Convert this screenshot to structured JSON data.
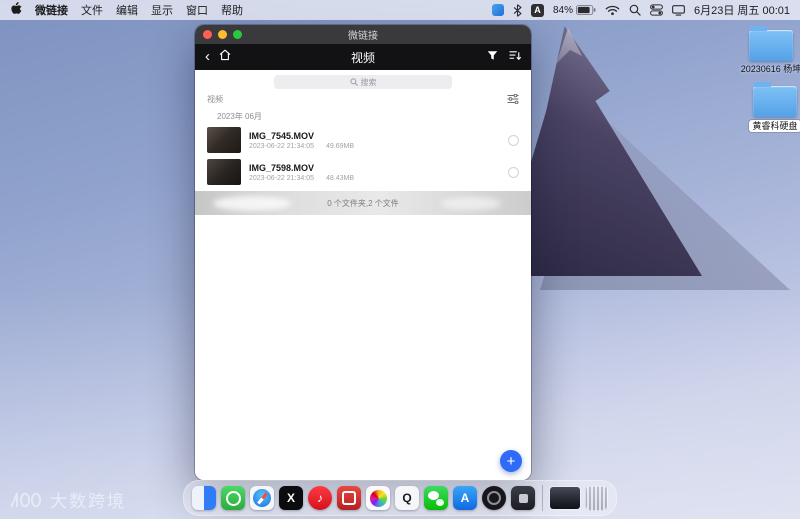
{
  "menu_bar": {
    "app_menu_items": [
      "微链接",
      "文件",
      "编辑",
      "显示",
      "窗口",
      "帮助"
    ],
    "input_source": "A",
    "battery_percent": "84%",
    "clock": "6月23日 周五 00:01"
  },
  "window": {
    "title": "微链接",
    "nav": {
      "back_glyph": "‹",
      "title": "视频"
    },
    "search": {
      "placeholder": "搜索"
    },
    "section_label": "视频",
    "group_header": "2023年 06月",
    "items": [
      {
        "name": "IMG_7545.MOV",
        "date": "2023-06-22 21:34:05",
        "size": "49.69MB"
      },
      {
        "name": "IMG_7598.MOV",
        "date": "2023-06-22 21:34:05",
        "size": "48.43MB"
      }
    ],
    "footer_status": "0 个文件夹,2 个文件",
    "fab_label": "+"
  },
  "desktop": {
    "folders": [
      {
        "label": "20230616 杨坤"
      },
      {
        "label": "黄睿科硬盘"
      }
    ],
    "watermark": "大数跨境"
  },
  "dock": {
    "apps": [
      {
        "name": "finder",
        "glyph": ""
      },
      {
        "name": "green-app",
        "glyph": ""
      },
      {
        "name": "safari",
        "glyph": ""
      },
      {
        "name": "capcut",
        "glyph": "X"
      },
      {
        "name": "music-app",
        "glyph": "♪"
      },
      {
        "name": "red-app",
        "glyph": ""
      },
      {
        "name": "photos",
        "glyph": ""
      },
      {
        "name": "qq",
        "glyph": "Q"
      },
      {
        "name": "wechat",
        "glyph": ""
      },
      {
        "name": "app-store",
        "glyph": "A"
      },
      {
        "name": "camera-app",
        "glyph": ""
      },
      {
        "name": "utility-app",
        "glyph": ""
      }
    ]
  }
}
